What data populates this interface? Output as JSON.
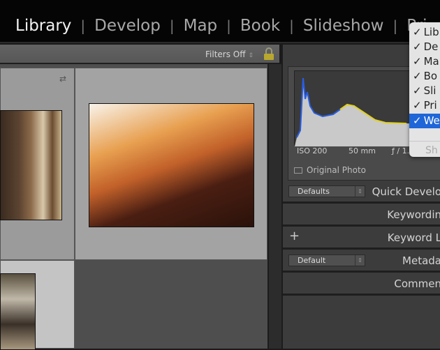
{
  "modules": [
    {
      "label": "Library",
      "active": true
    },
    {
      "label": "Develop"
    },
    {
      "label": "Map"
    },
    {
      "label": "Book"
    },
    {
      "label": "Slideshow"
    },
    {
      "label": "Pri"
    }
  ],
  "separator": "|",
  "filterbar": {
    "label": "Filters Off",
    "arrow": "⌃⌄"
  },
  "histogram": {
    "title": "Hi",
    "iso": "ISO 200",
    "focal": "50 mm",
    "aperture": "ƒ / 1.",
    "original_photo": "Original Photo"
  },
  "panels": {
    "quick_develop": {
      "label": "Quick Develo",
      "preset": "Defaults"
    },
    "keywording": {
      "label": "Keywordin"
    },
    "keyword_list": {
      "label": "Keyword L",
      "plus": "+"
    },
    "metadata": {
      "label": "Metada",
      "preset": "Default"
    },
    "comments": {
      "label": "Commen"
    }
  },
  "menu": {
    "items": [
      {
        "label": "Lib"
      },
      {
        "label": "De"
      },
      {
        "label": "Ma"
      },
      {
        "label": "Bo"
      },
      {
        "label": "Sli"
      },
      {
        "label": "Pri"
      },
      {
        "label": "We",
        "highlighted": true
      }
    ],
    "check": "✓",
    "disabled": "Sh"
  }
}
